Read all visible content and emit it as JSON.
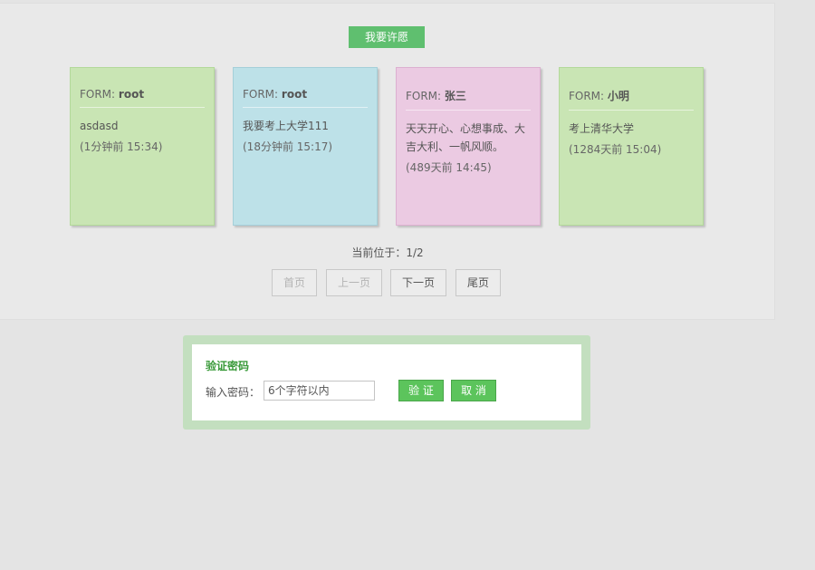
{
  "wish_button": "我要许愿",
  "colors": {
    "green_card": "#c9e5b4",
    "blue_card": "#bde1e8",
    "pink_card": "#ebcae2",
    "accent": "#5fbf6f"
  },
  "cards": [
    {
      "from_label": "FORM:",
      "author": "root",
      "content": "asdasd",
      "time": "(1分钟前 15:34)",
      "color": "#c9e5b4",
      "border": "#b3d99a"
    },
    {
      "from_label": "FORM:",
      "author": "root",
      "content": "我要考上大学111",
      "time": "(18分钟前 15:17)",
      "color": "#bde1e8",
      "border": "#a5cfd9"
    },
    {
      "from_label": "FORM:",
      "author": "张三",
      "content": "天天开心、心想事成、大吉大利、一帆风顺。",
      "time": "(489天前 14:45)",
      "color": "#ebcae2",
      "border": "#dcb0d0"
    },
    {
      "from_label": "FORM:",
      "author": "小明",
      "content": "考上清华大学",
      "time": "(1284天前 15:04)",
      "color": "#c9e5b4",
      "border": "#b3d99a"
    }
  ],
  "pager": {
    "current_text": "当前位于：1/2",
    "first": "首页",
    "prev": "上一页",
    "next": "下一页",
    "last": "尾页"
  },
  "verify": {
    "title": "验证密码",
    "label": "输入密码：",
    "placeholder": "6个字符以内",
    "verify_button": "验 证",
    "cancel_button": "取 消"
  }
}
